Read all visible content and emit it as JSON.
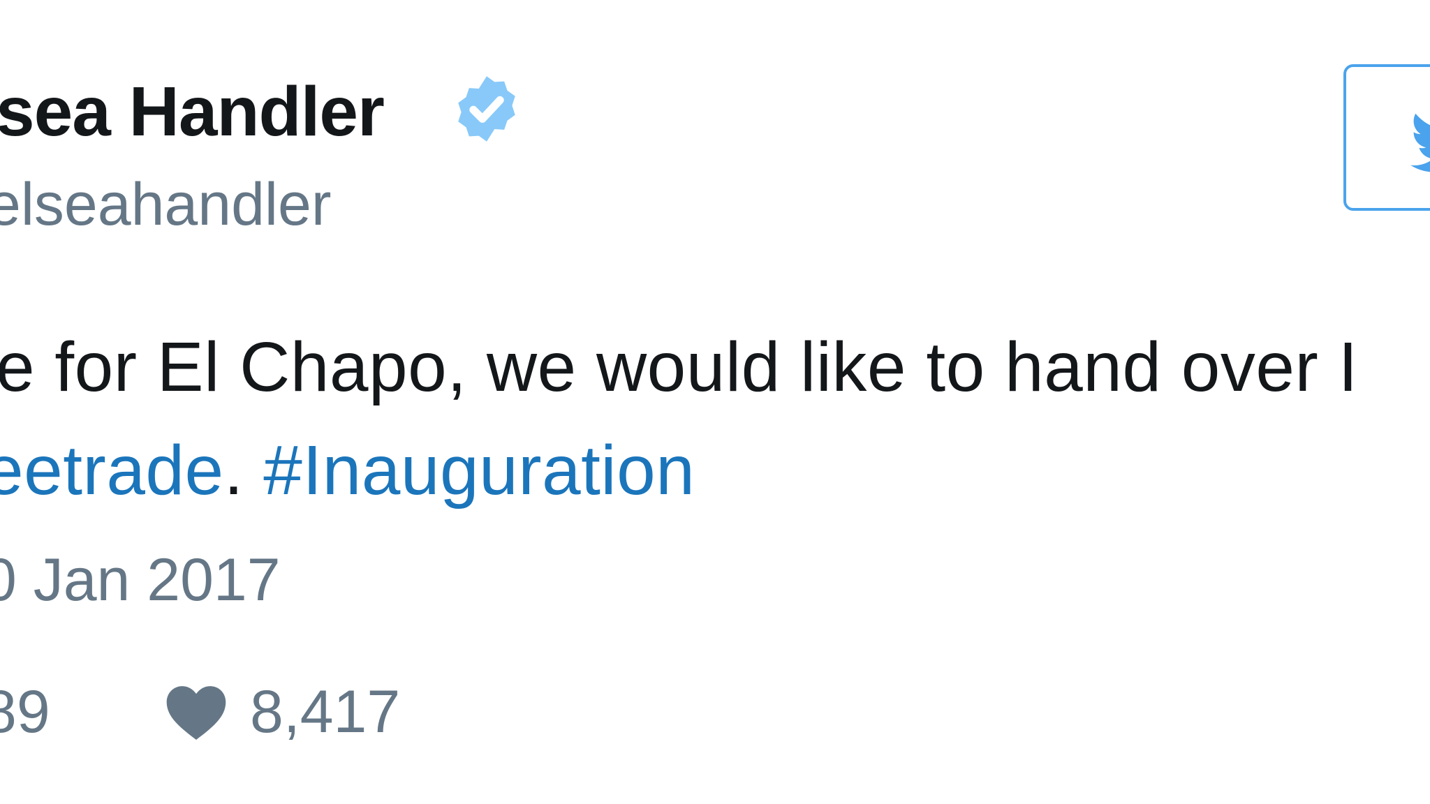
{
  "tweet": {
    "display_name": "sea Handler",
    "handle": "elseahandler",
    "text_line1": "e for El Chapo, we would like to hand over I",
    "text_line2_link1": "eetrade",
    "text_line2_separator": ". ",
    "text_line2_link2": "#Inauguration",
    "timestamp": "0 Jan 2017",
    "retweet_count": "89",
    "like_count": "8,417"
  },
  "icons": {
    "verified": "verified-badge-icon",
    "like": "heart-icon",
    "twitter": "twitter-bird-icon"
  },
  "colors": {
    "verified_blue": "#88c9f9",
    "link_blue": "#1b75bb",
    "muted_gray": "#657786",
    "button_border": "#4aa3ec",
    "bird_blue": "#4aa3ec"
  }
}
